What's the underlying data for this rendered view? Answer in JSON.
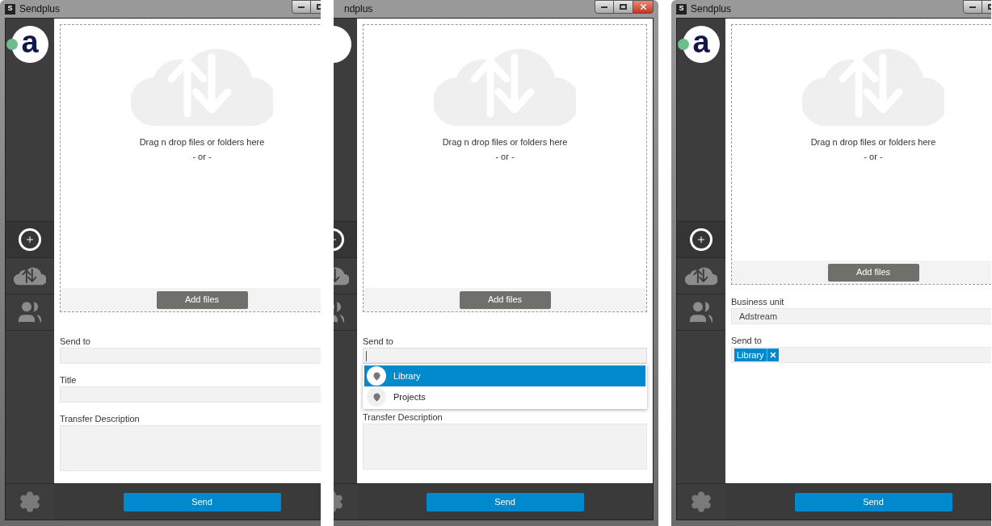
{
  "windows": [
    {
      "title": "Sendplus",
      "icon_label": "S",
      "logo_text": "a",
      "nav": [
        {
          "kind": "add",
          "selected": true
        },
        {
          "kind": "transfer",
          "selected": false
        },
        {
          "kind": "contacts",
          "selected": false
        }
      ],
      "dropzone": {
        "text": "Drag n drop files or folders here",
        "or": "- or -",
        "button": "Add files"
      },
      "fields": [
        {
          "kind": "text",
          "label": "Send to",
          "focused": false
        },
        {
          "kind": "text",
          "label": "Title"
        },
        {
          "kind": "textarea",
          "label": "Transfer Description"
        }
      ],
      "send_button": "Send"
    },
    {
      "title": "ndplus",
      "nav": [
        {
          "kind": "add",
          "selected": true
        },
        {
          "kind": "transfer",
          "selected": false
        },
        {
          "kind": "contacts",
          "selected": false
        }
      ],
      "dropzone": {
        "text": "Drag n drop files or folders here",
        "or": "- or -",
        "button": "Add files"
      },
      "fields": [
        {
          "kind": "text",
          "label": "Send to",
          "focused": true,
          "options": [
            {
              "label": "Library",
              "selected": true
            },
            {
              "label": "Projects",
              "selected": false
            }
          ]
        },
        {
          "kind": "covered"
        },
        {
          "kind": "textarea",
          "label": "Transfer Description"
        }
      ],
      "send_button": "Send"
    },
    {
      "title": "Sendplus",
      "icon_label": "S",
      "logo_text": "a",
      "nav": [
        {
          "kind": "add",
          "selected": true
        },
        {
          "kind": "transfer",
          "selected": false
        },
        {
          "kind": "contacts",
          "selected": false
        }
      ],
      "dropzone": {
        "text": "Drag n drop files or folders here",
        "or": "- or -",
        "button": "Add files"
      },
      "fields": [
        {
          "kind": "text",
          "label": "Business unit",
          "value": "Adstream"
        },
        {
          "kind": "tags",
          "label": "Send to",
          "tags": [
            "Library"
          ]
        }
      ],
      "send_button": "Send"
    }
  ]
}
